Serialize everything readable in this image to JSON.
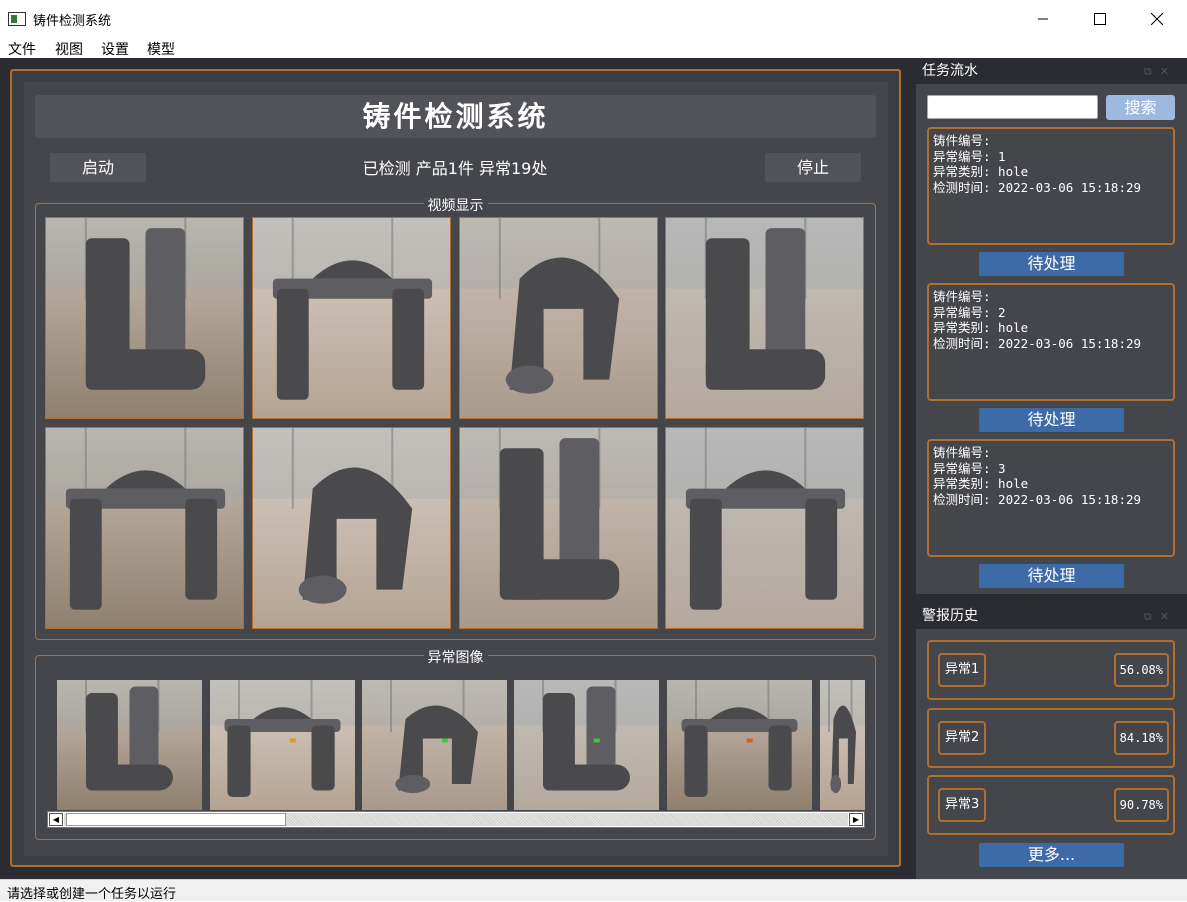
{
  "window": {
    "title": "铸件检测系统",
    "minimize_glyph": "—",
    "maximize_glyph": "☐",
    "close_glyph": "✕"
  },
  "menu": [
    "文件",
    "视图",
    "设置",
    "模型"
  ],
  "header": {
    "title": "铸件检测系统"
  },
  "controls": {
    "start_label": "启动",
    "stop_label": "停止",
    "status": "已检测 产品1件 异常19处"
  },
  "video_group": {
    "title": "视频显示"
  },
  "anomaly_group": {
    "title": "异常图像"
  },
  "task_panel": {
    "title": "任务流水",
    "search_placeholder": "",
    "search_label": "搜索",
    "tasks": [
      {
        "casting_label": "铸件编号:",
        "anomaly_label": "异常编号: 1",
        "type_label": "异常类别: hole",
        "time_label": "检测时间: 2022-03-06 15:18:29",
        "action": "待处理"
      },
      {
        "casting_label": "铸件编号:",
        "anomaly_label": "异常编号: 2",
        "type_label": "异常类别: hole",
        "time_label": "检测时间: 2022-03-06 15:18:29",
        "action": "待处理"
      },
      {
        "casting_label": "铸件编号:",
        "anomaly_label": "异常编号: 3",
        "type_label": "异常类别: hole",
        "time_label": "检测时间: 2022-03-06 15:18:29",
        "action": "待处理"
      }
    ]
  },
  "alarm_panel": {
    "title": "警报历史",
    "alarms": [
      {
        "name": "异常1",
        "value": "56.08%"
      },
      {
        "name": "异常2",
        "value": "84.18%"
      },
      {
        "name": "异常3",
        "value": "90.78%"
      }
    ],
    "more_label": "更多..."
  },
  "status_bar": {
    "text": "请选择或创建一个任务以运行"
  },
  "colors": {
    "accent": "#b06e30",
    "button_blue": "#3e6aa8",
    "search_blue": "#9eb9df",
    "background": "#2b2c31",
    "panel": "#45464c"
  }
}
